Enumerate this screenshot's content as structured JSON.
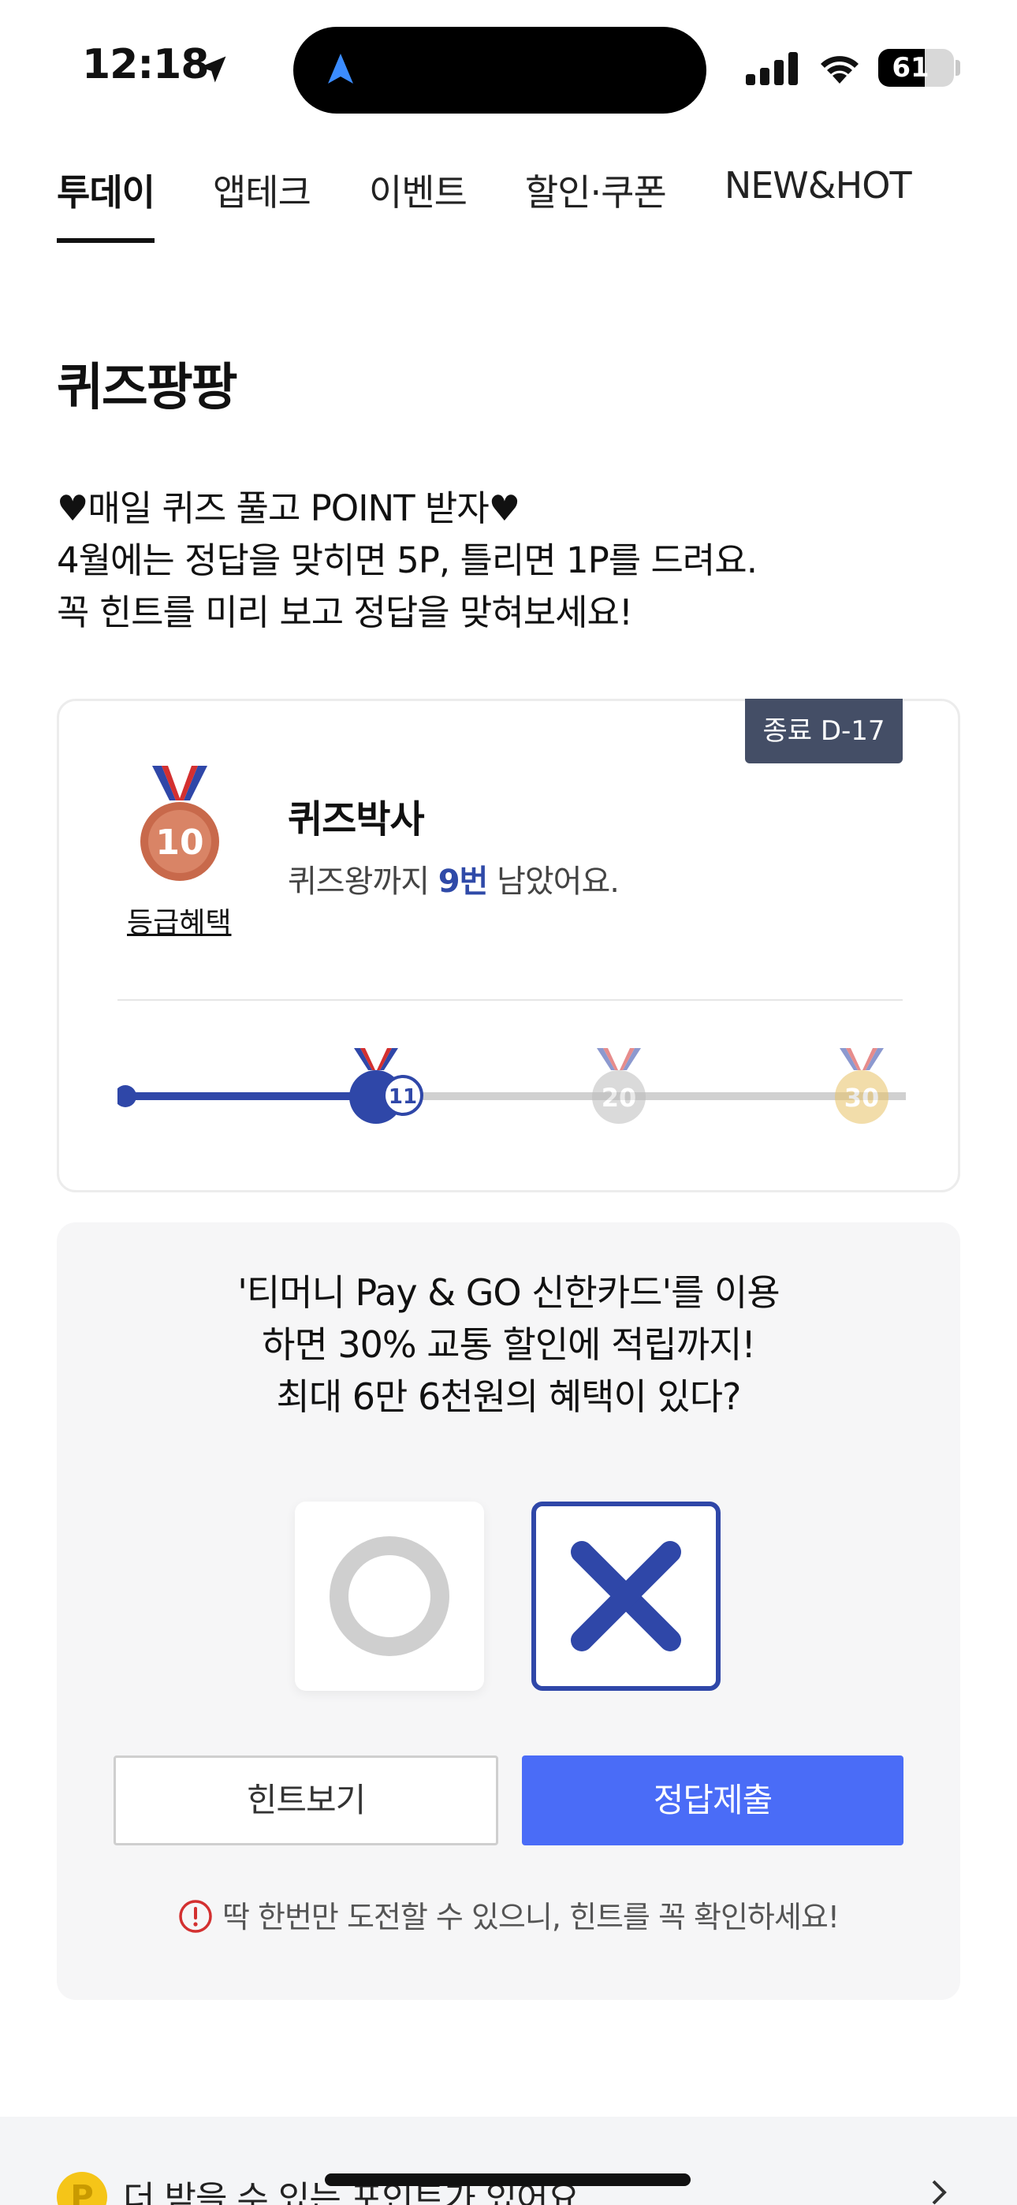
{
  "status_bar": {
    "time": "12:18",
    "battery": "61",
    "icons": [
      "location-arrow-icon",
      "navigation-icon",
      "signal-icon",
      "wifi-icon",
      "battery-icon"
    ]
  },
  "tabs": [
    {
      "label": "투데이",
      "active": true
    },
    {
      "label": "앱테크",
      "active": false
    },
    {
      "label": "이벤트",
      "active": false
    },
    {
      "label": "할인·쿠폰",
      "active": false
    },
    {
      "label": "NEW&HOT",
      "active": false
    }
  ],
  "page_title": "퀴즈팡팡",
  "intro": {
    "line1": "♥매일 퀴즈 풀고 POINT 받자♥",
    "line2": "4월에는 정답을 맞히면 5P, 틀리면 1P를 드려요.",
    "line3": "꼭 힌트를 미리 보고 정답을 맞혀보세요!"
  },
  "grade": {
    "dday": "종료 D-17",
    "medal_level": "10",
    "benefit_link": "등급혜택",
    "title": "퀴즈박사",
    "sub_prefix": "퀴즈왕까지 ",
    "sub_count": "9번",
    "sub_suffix": " 남았어요.",
    "milestones": [
      "11",
      "20",
      "30"
    ],
    "progress_fraction": 0.33
  },
  "quiz": {
    "question_line1": "'티머니 Pay & GO 신한카드'를 이용",
    "question_line2": "하면 30% 교통 할인에 적립까지!",
    "question_line3": "최대 6만 6천원의 혜택이 있다?",
    "selected_answer": "X",
    "hint_button": "힌트보기",
    "submit_button": "정답제출",
    "warning": "딱 한번만 도전할 수 있으니, 힌트를 꼭 확인하세요!"
  },
  "banner": {
    "coin": "P",
    "text": "더 받을 수 있는 포인트가 있어요"
  },
  "colors": {
    "accent_blue": "#4a6cf7",
    "navy": "#2f47a8",
    "dday_bg": "#444e66",
    "bronze": "#c8694b",
    "warning_red": "#d33030"
  }
}
